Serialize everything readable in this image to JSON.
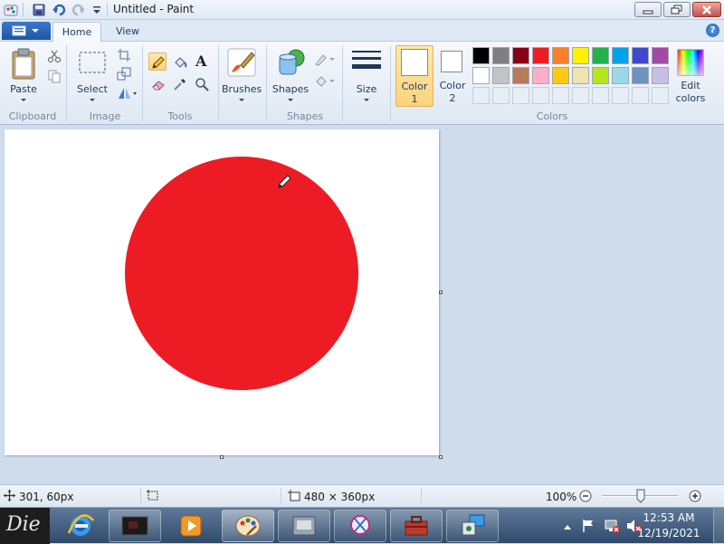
{
  "window": {
    "title": "Untitled - Paint"
  },
  "tabs": [
    {
      "label": "Home"
    },
    {
      "label": "View"
    }
  ],
  "ribbon": {
    "clipboard": {
      "paste_label": "Paste",
      "group_label": "Clipboard"
    },
    "image": {
      "select_label": "Select",
      "group_label": "Image"
    },
    "tools": {
      "group_label": "Tools",
      "text_tool_glyph": "A"
    },
    "brushes": {
      "label": "Brushes"
    },
    "shapes": {
      "label": "Shapes",
      "group_label": "Shapes"
    },
    "size": {
      "label": "Size"
    },
    "color1": {
      "line1": "Color",
      "line2": "1",
      "value": "#ffffff"
    },
    "color2": {
      "line1": "Color",
      "line2": "2",
      "value": "#ffffff"
    },
    "edit_colors": {
      "line1": "Edit",
      "line2": "colors"
    },
    "colors_group_label": "Colors",
    "palette_row1": [
      "#000000",
      "#7f7f7f",
      "#880015",
      "#ed1c24",
      "#ff7f27",
      "#fff200",
      "#22b14c",
      "#00a2e8",
      "#3f48cc",
      "#a349a4"
    ],
    "palette_row2": [
      "#ffffff",
      "#c3c3c3",
      "#b97a57",
      "#ffaec9",
      "#ffc90e",
      "#efe4b0",
      "#b5e61d",
      "#99d9ea",
      "#7092be",
      "#c8bfe7"
    ]
  },
  "canvas": {
    "background": "#ffffff",
    "circle_color": "#ed1c24",
    "cursor_icon": "pencil-cursor-icon"
  },
  "statusbar": {
    "cursor_position": "301, 60px",
    "canvas_size": "480 × 360px",
    "zoom": "100%"
  },
  "taskbar": {
    "start_label": "Die",
    "clock_time": "12:53 AM",
    "clock_date": "12/19/2021"
  }
}
